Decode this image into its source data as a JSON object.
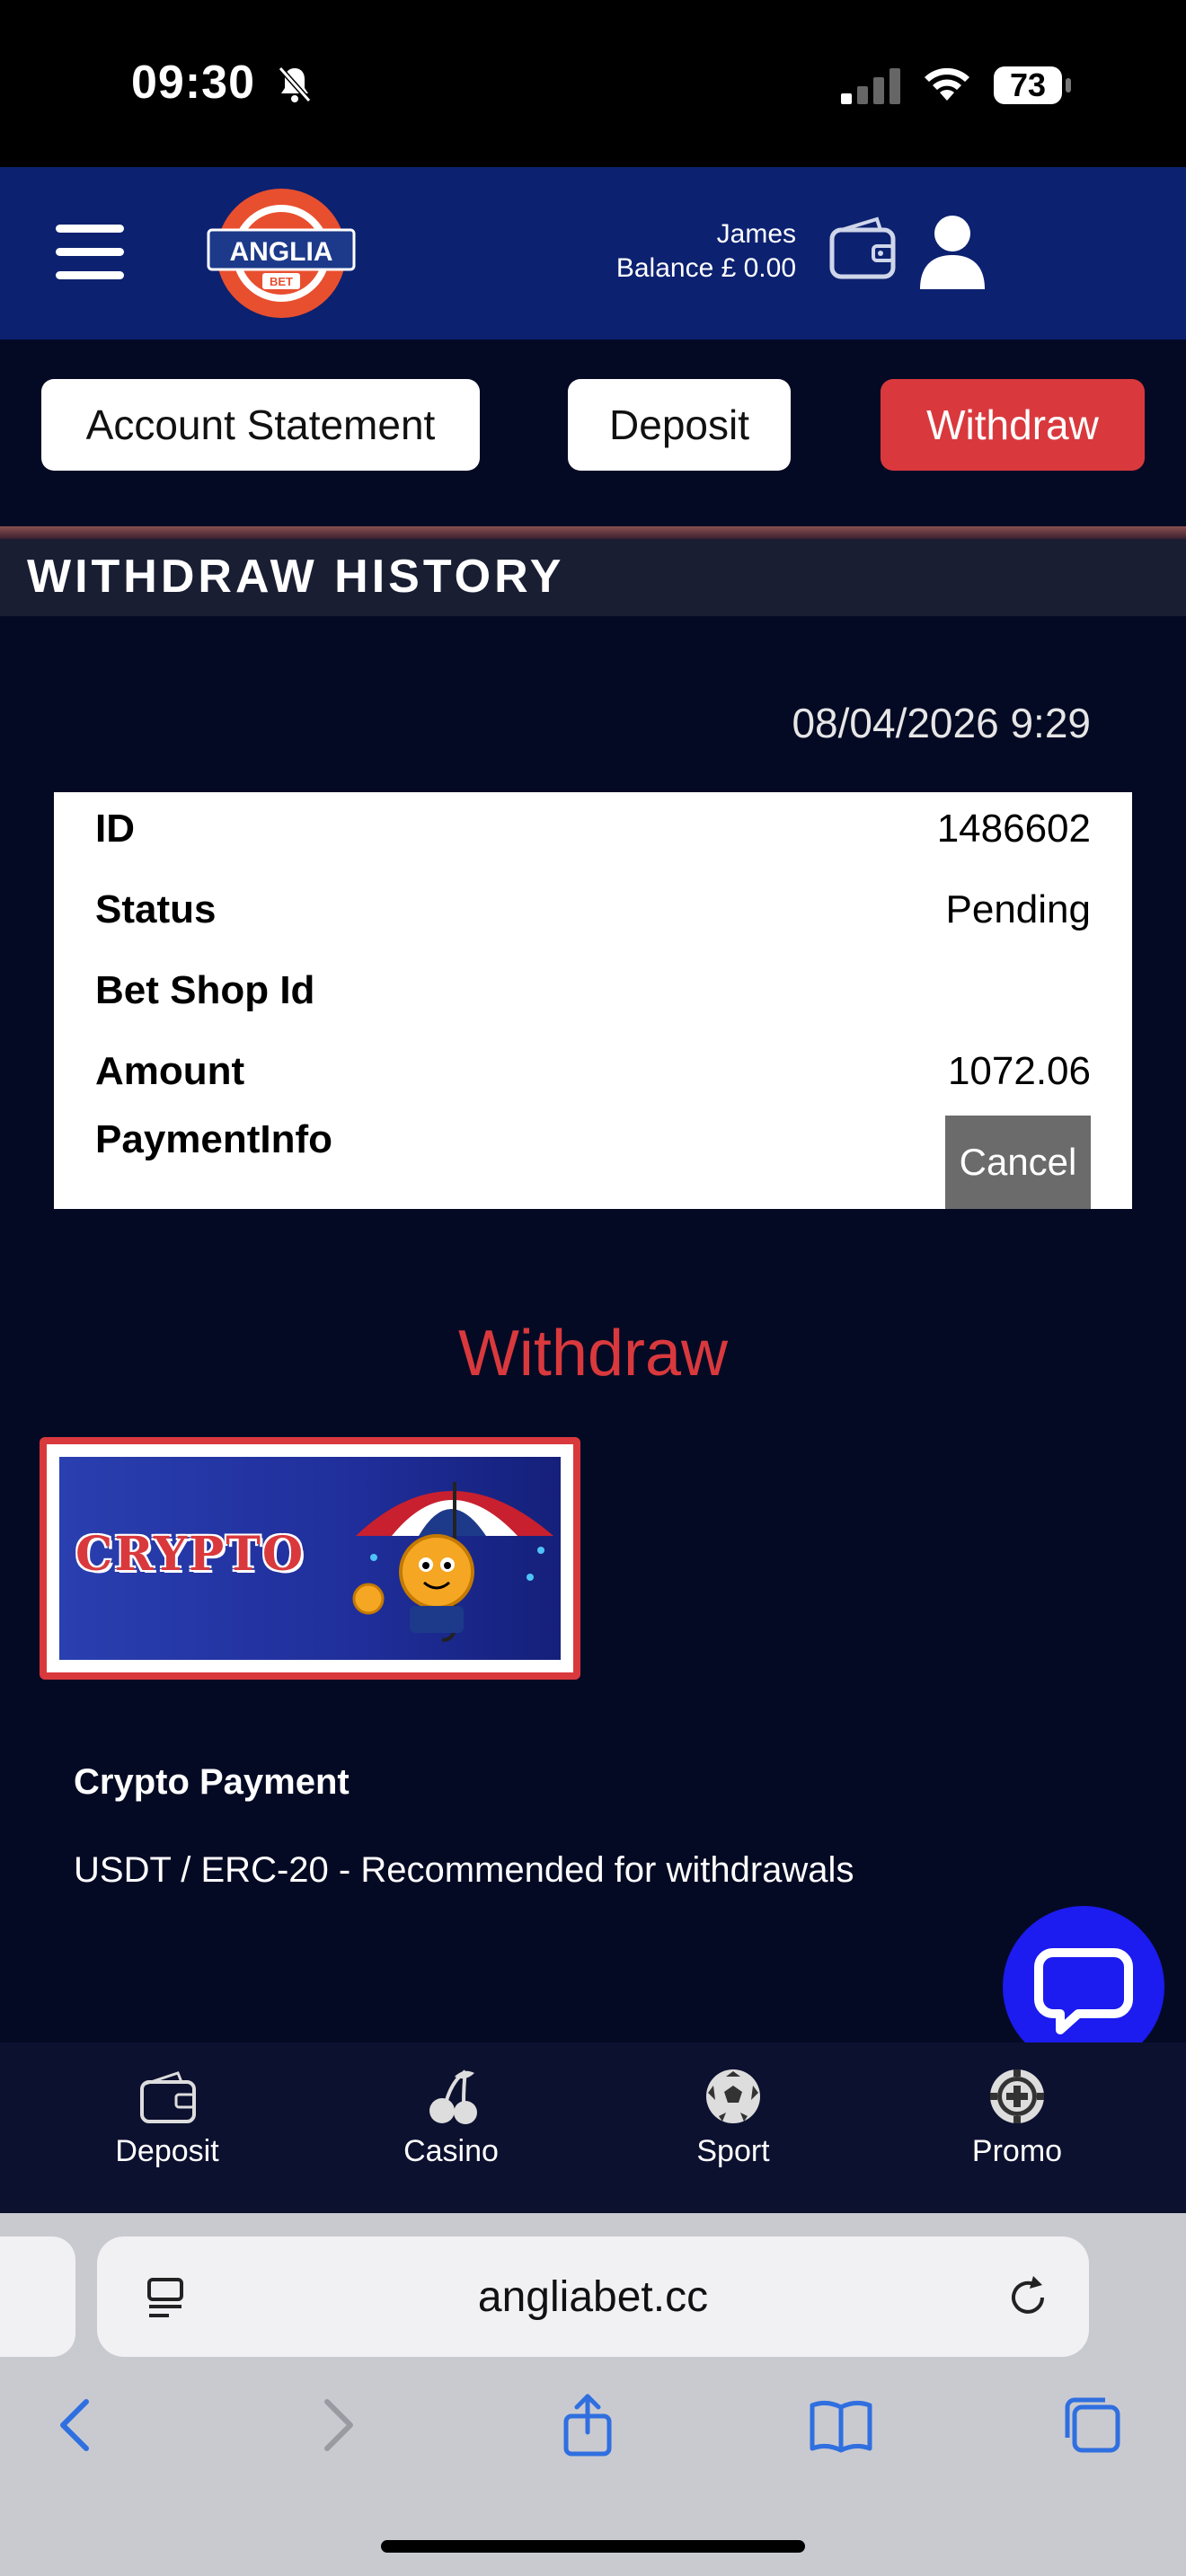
{
  "status_bar": {
    "time": "09:30",
    "battery": "73"
  },
  "header": {
    "logo_text": "ANGLIA",
    "logo_subtext": "BET",
    "user_name": "James",
    "balance": "Balance £ 0.00"
  },
  "tabs": {
    "statement": "Account Statement",
    "deposit": "Deposit",
    "withdraw": "Withdraw"
  },
  "section_title": "WITHDRAW HISTORY",
  "history": {
    "date": "08/04/2026 9:29",
    "rows": {
      "id": {
        "label": "ID",
        "value": "1486602"
      },
      "status": {
        "label": "Status",
        "value": "Pending"
      },
      "bet_shop": {
        "label": "Bet Shop Id",
        "value": ""
      },
      "amount": {
        "label": "Amount",
        "value": "1072.06"
      },
      "payment": {
        "label": "PaymentInfo",
        "value": ""
      }
    },
    "cancel_label": "Cancel"
  },
  "withdraw": {
    "heading": "Withdraw",
    "method_banner_text": "CRYPTO",
    "payment_title": "Crypto Payment",
    "payment_desc": "USDT / ERC-20 - Recommended for withdrawals"
  },
  "bottom_nav": [
    {
      "label": "Deposit",
      "icon": "wallet-icon"
    },
    {
      "label": "Casino",
      "icon": "cherries-icon"
    },
    {
      "label": "Sport",
      "icon": "soccer-ball-icon"
    },
    {
      "label": "Promo",
      "icon": "chip-icon"
    }
  ],
  "browser": {
    "url": "angliabet.cc"
  },
  "colors": {
    "header": "#0c2170",
    "accent": "#d9393d",
    "background": "#050a24",
    "chat": "#1c1bf0"
  }
}
